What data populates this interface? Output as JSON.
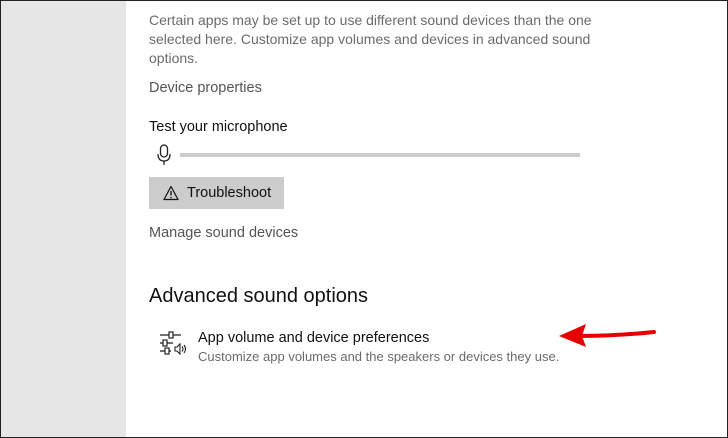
{
  "settings": {
    "note": "Certain apps may be set up to use different sound devices than the one selected here. Customize app volumes and devices in advanced sound options.",
    "device_properties_link": "Device properties",
    "test_mic_label": "Test your microphone",
    "troubleshoot_button": "Troubleshoot",
    "manage_devices_link": "Manage sound devices",
    "mic_level": 0
  },
  "advanced": {
    "title": "Advanced sound options",
    "app_volume": {
      "title": "App volume and device preferences",
      "description": "Customize app volumes and the speakers or devices they use."
    }
  },
  "colors": {
    "left_pane": "#e6e6e6",
    "button_bg": "#cccccc",
    "annotation_arrow": "#e60000"
  },
  "icons": {
    "microphone": "microphone-icon",
    "warning": "warning-icon",
    "app_volume": "sliders-speaker-icon"
  }
}
